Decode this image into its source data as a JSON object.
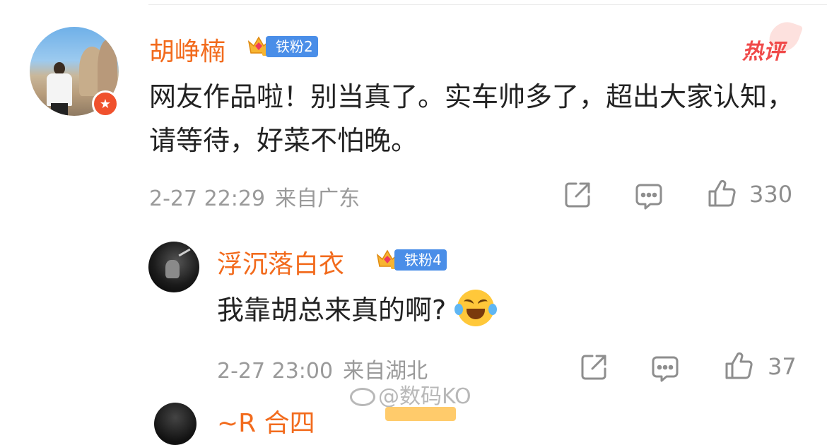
{
  "main_comment": {
    "username": "胡峥楠",
    "fan_badge": "铁粉2",
    "hot_tag": "热评",
    "text": "网友作品啦！别当真了。实车帅多了，超出大家认知，请等待，好菜不怕晚。",
    "time": "2-27 22:29",
    "location": "来自广东",
    "like_count": "330"
  },
  "reply": {
    "username": "浮沉落白衣",
    "fan_badge": "铁粉4",
    "text": "我靠胡总来真的啊?",
    "time": "2-27 23:00",
    "location": "来自湖北",
    "like_count": "37"
  },
  "watermark": "@数码KO",
  "next_partial": {
    "username": "~R  合四"
  },
  "colors": {
    "username": "#f26b1d",
    "fan_badge": "#4a8ee8",
    "hot": "#f04a4a",
    "meta": "#9a9a9a",
    "text": "#222222"
  },
  "icons": [
    "share-icon",
    "comment-icon",
    "like-icon",
    "crown-icon",
    "verified-badge-icon",
    "laugh-cry-emoji"
  ]
}
